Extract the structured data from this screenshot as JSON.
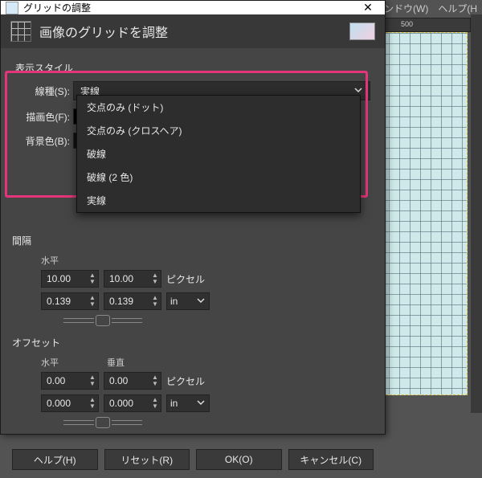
{
  "menubar": {
    "window": "ウィンドウ(W)",
    "help": "ヘルプ(H"
  },
  "ruler": {
    "tick500": "500"
  },
  "dialog": {
    "title": "グリッドの調整",
    "header_title": "画像のグリッドを調整",
    "style_section": "表示スタイル",
    "line_style": {
      "label": "線種(S):",
      "selected": "実線",
      "options": {
        "opt0": "交点のみ (ドット)",
        "opt1": "交点のみ (クロスヘア)",
        "opt2": "破線",
        "opt3": "破線 (2 色)",
        "opt4": "実線"
      }
    },
    "fg": {
      "label": "描画色(F):"
    },
    "bg": {
      "label": "背景色(B):"
    },
    "spacing": {
      "label": "間隔",
      "h_label": "水平",
      "v_label": "",
      "h_px": "10.00",
      "v_px": "10.00",
      "px_unit": "ピクセル",
      "h_in": "0.139",
      "v_in": "0.139",
      "in_unit": "in"
    },
    "offset": {
      "label": "オフセット",
      "h_label": "水平",
      "v_label": "垂直",
      "h_px": "0.00",
      "v_px": "0.00",
      "px_unit": "ピクセル",
      "h_in": "0.000",
      "v_in": "0.000",
      "in_unit": "in"
    },
    "buttons": {
      "help": "ヘルプ(H)",
      "reset": "リセット(R)",
      "ok": "OK(O)",
      "cancel": "キャンセル(C)"
    }
  }
}
